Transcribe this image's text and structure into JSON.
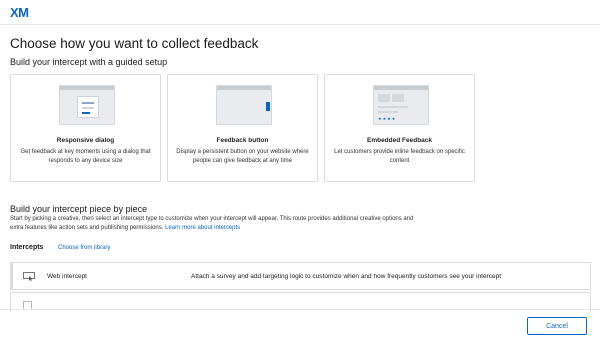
{
  "app": {
    "logo": "XM"
  },
  "page": {
    "title": "Choose how you want to collect feedback",
    "guided_heading": "Build your intercept with a guided setup"
  },
  "cards": [
    {
      "title": "Responsive dialog",
      "description": "Get feedback at key moments using a dialog that responds to any device size",
      "icon": "responsive-dialog-illustration"
    },
    {
      "title": "Feedback button",
      "description": "Display a persistent button on your website where people can give feedback at any time",
      "icon": "feedback-button-illustration"
    },
    {
      "title": "Embedded Feedback",
      "description": "Let customers provide inline feedback on specific content",
      "icon": "embedded-feedback-illustration"
    }
  ],
  "piece": {
    "heading": "Build your intercept piece by piece",
    "body": "Start by picking a creative, then select an intercept type to customize when your intercept will appear. This route provides additional creative options and extra features like action sets and publishing permissions.",
    "link": "Learn more about intercepts"
  },
  "intercepts": {
    "label": "Intercepts",
    "library_link": "Choose from library",
    "rows": [
      {
        "name": "Web intercept",
        "description": "Attach a survey and add targeting logic to customize when and how frequently customers see your intercept",
        "icon": "cursor-icon"
      },
      {
        "name": "",
        "description": "",
        "icon": "checkbox-icon"
      }
    ]
  },
  "footer": {
    "cancel_label": "Cancel"
  },
  "colors": {
    "accent": "#0a66c2",
    "border": "#d9dde2"
  }
}
